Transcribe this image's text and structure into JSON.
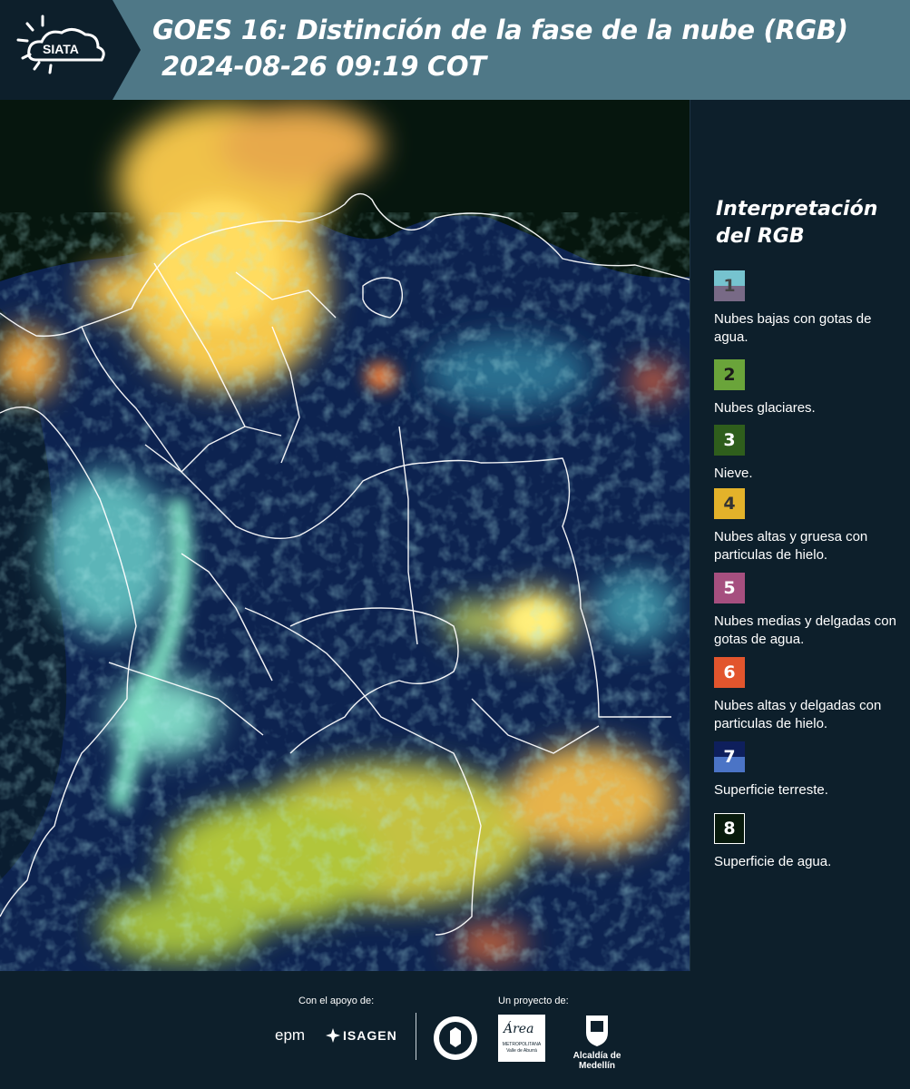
{
  "header": {
    "logo_text": "SIATA",
    "title": "GOES 16: Distinción de la fase de la nube (RGB)",
    "subtitle": "2024-08-26 09:19 COT",
    "background_color": "#4f7887"
  },
  "map": {
    "type": "satellite-rgb-composite",
    "region": "Colombia",
    "border_color": "#ffffff"
  },
  "legend": {
    "title": "Interpretación del RGB",
    "items": [
      {
        "number": "1",
        "label": "Nubes bajas con gotas de agua.",
        "colors": [
          "#76c3cf",
          "#786a86"
        ]
      },
      {
        "number": "2",
        "label": "Nubes glaciares.",
        "colors": [
          "#6aa43a"
        ]
      },
      {
        "number": "3",
        "label": "Nieve.",
        "colors": [
          "#2f5e1c"
        ]
      },
      {
        "number": "4",
        "label": "Nubes altas y gruesa con particulas de hielo.",
        "colors": [
          "#e3b22a"
        ]
      },
      {
        "number": "5",
        "label": "Nubes medias y delgadas con gotas de agua.",
        "colors": [
          "#a64f7f"
        ]
      },
      {
        "number": "6",
        "label": "Nubes altas y delgadas con particulas de hielo.",
        "colors": [
          "#e2552d"
        ]
      },
      {
        "number": "7",
        "label": "Superficie terreste.",
        "colors": [
          "#0e1f5c",
          "#4b74c6"
        ]
      },
      {
        "number": "8",
        "label": "Superficie de agua.",
        "colors": [
          "#081a0c"
        ]
      }
    ]
  },
  "footer": {
    "support_label": "Con el apoyo de:",
    "project_label": "Un proyecto de:",
    "sponsors": [
      "epm",
      "ISAGEN"
    ],
    "partners": [
      "METROPOLITANA Valle de Aburrá",
      "Alcaldía de Medellín"
    ],
    "area_logo_text": "Área"
  }
}
